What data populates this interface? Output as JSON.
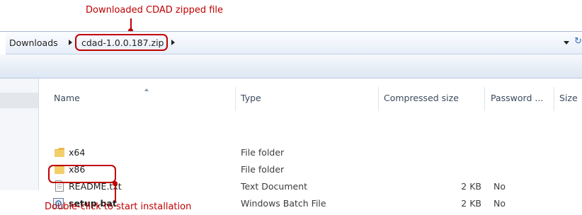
{
  "callouts": {
    "top": "Downloaded CDAD zipped file",
    "bottom": "Double-click to start installation"
  },
  "breadcrumb": {
    "items": [
      "Downloads",
      "cdad-1.0.0.187.zip"
    ]
  },
  "columns": [
    "Name",
    "Type",
    "Compressed size",
    "Password ...",
    "Size"
  ],
  "files": [
    {
      "name": "x64",
      "type": "File folder",
      "compressed_size": "",
      "password": "",
      "icon": "folder-icon"
    },
    {
      "name": "x86",
      "type": "File folder",
      "compressed_size": "",
      "password": "",
      "icon": "folder-icon"
    },
    {
      "name": "README.txt",
      "type": "Text Document",
      "compressed_size": "2 KB",
      "password": "No",
      "icon": "text-file-icon"
    },
    {
      "name": "setup.bat",
      "type": "Windows Batch File",
      "compressed_size": "2 KB",
      "password": "No",
      "icon": "batch-file-icon"
    }
  ],
  "colors": {
    "annotation": "#c00000",
    "folder": "#e8b84a"
  }
}
